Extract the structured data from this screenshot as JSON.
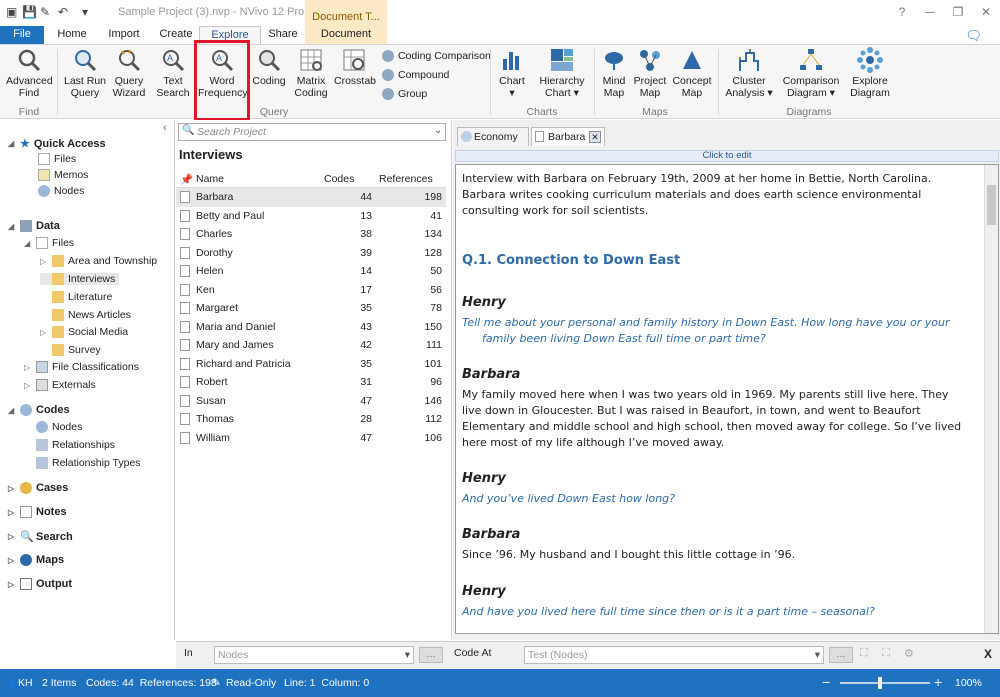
{
  "app": {
    "title": "Sample Project (3).nvp - NVivo 12 Pro",
    "context_tab_header": "Document T...",
    "window_controls": [
      "?",
      "─",
      "❐",
      "✕"
    ]
  },
  "ribbon_tabs": [
    "File",
    "Home",
    "Import",
    "Create",
    "Explore",
    "Share",
    "Document"
  ],
  "ribbon": {
    "find": {
      "advanced_find": "Advanced Find",
      "group": "Find"
    },
    "query": {
      "last_run": "Last Run Query",
      "wizard": "Query Wizard",
      "text_search": "Text Search",
      "word_frequency": "Word Frequency",
      "coding": "Coding",
      "matrix": "Matrix Coding",
      "crosstab": "Crosstab",
      "coding_comparison": "Coding Comparison",
      "compound": "Compound",
      "group_btn": "Group",
      "group": "Query"
    },
    "charts": {
      "chart": "Chart",
      "hierarchy": "Hierarchy Chart",
      "group": "Charts"
    },
    "maps": {
      "mind": "Mind Map",
      "project": "Project Map",
      "concept": "Concept Map",
      "group": "Maps"
    },
    "diagrams": {
      "cluster": "Cluster Analysis",
      "comparison": "Comparison Diagram",
      "explore": "Explore Diagram",
      "group": "Diagrams"
    }
  },
  "nav": {
    "quick_access": "Quick Access",
    "qa_items": [
      "Files",
      "Memos",
      "Nodes"
    ],
    "data": "Data",
    "files": "Files",
    "file_folders": [
      "Area and Township",
      "Interviews",
      "Literature",
      "News Articles",
      "Social Media",
      "Survey"
    ],
    "file_classifications": "File Classifications",
    "externals": "Externals",
    "codes": "Codes",
    "codes_items": [
      "Nodes",
      "Relationships",
      "Relationship Types"
    ],
    "cases": "Cases",
    "notes": "Notes",
    "search": "Search",
    "maps": "Maps",
    "output": "Output"
  },
  "list": {
    "search_placeholder": "Search Project",
    "title": "Interviews",
    "columns": [
      "Name",
      "Codes",
      "References"
    ],
    "rows": [
      {
        "name": "Barbara",
        "codes": "44",
        "refs": "198"
      },
      {
        "name": "Betty and Paul",
        "codes": "13",
        "refs": "41"
      },
      {
        "name": "Charles",
        "codes": "38",
        "refs": "134"
      },
      {
        "name": "Dorothy",
        "codes": "39",
        "refs": "128"
      },
      {
        "name": "Helen",
        "codes": "14",
        "refs": "50"
      },
      {
        "name": "Ken",
        "codes": "17",
        "refs": "56"
      },
      {
        "name": "Margaret",
        "codes": "35",
        "refs": "78"
      },
      {
        "name": "Maria and Daniel",
        "codes": "43",
        "refs": "150"
      },
      {
        "name": "Mary and James",
        "codes": "42",
        "refs": "111"
      },
      {
        "name": "Richard and Patricia",
        "codes": "35",
        "refs": "101"
      },
      {
        "name": "Robert",
        "codes": "31",
        "refs": "96"
      },
      {
        "name": "Susan",
        "codes": "47",
        "refs": "146"
      },
      {
        "name": "Thomas",
        "codes": "28",
        "refs": "112"
      },
      {
        "name": "William",
        "codes": "47",
        "refs": "106"
      }
    ]
  },
  "doc": {
    "tabs": [
      "Economy",
      "Barbara"
    ],
    "click_to_edit": "Click to edit",
    "intro": "Interview with Barbara on February 19th, 2009 at her home in Bettie, North Carolina. Barbara writes cooking curriculum materials and does earth science environmental consulting work for soil scientists.",
    "heading": "Q.1. Connection to Down East",
    "blocks": [
      {
        "speaker": "Henry",
        "text": "Tell me about your personal and family history in Down East. How long have you or your family been living Down East full time or part time?"
      },
      {
        "speaker": "Barbara",
        "text": "My family moved here when I was two years old in 1969. My parents still live here. They live down in Gloucester. But I was raised in Beaufort, in town, and went to Beaufort Elementary and middle school and high school, then moved away for college. So I’ve lived here most of my life although I’ve moved away."
      },
      {
        "speaker": "Henry",
        "text": "And you’ve lived Down East how long?"
      },
      {
        "speaker": "Barbara",
        "text": "Since ’96. My husband and I bought this little cottage in ’96."
      },
      {
        "speaker": "Henry",
        "text": "And have you lived here full time since then or is it a part time – seasonal?"
      }
    ]
  },
  "bottom": {
    "in_label": "In",
    "in_value": "Nodes",
    "code_at_label": "Code At",
    "code_at_value": "Test (Nodes)",
    "dots": "...",
    "close": "X"
  },
  "status": {
    "user": "KH",
    "items": "2 Items",
    "codes_refs": "Codes: 44  References: 198",
    "readonly": "Read-Only",
    "position": "Line: 1  Column: 0",
    "zoom": "100%",
    "zoom_minus": "−",
    "zoom_plus": "+"
  },
  "colors": {
    "accent": "#1e72c0",
    "highlight": "#e0142a",
    "link": "#2e6aa8",
    "context_tab": "#fde9c6"
  }
}
